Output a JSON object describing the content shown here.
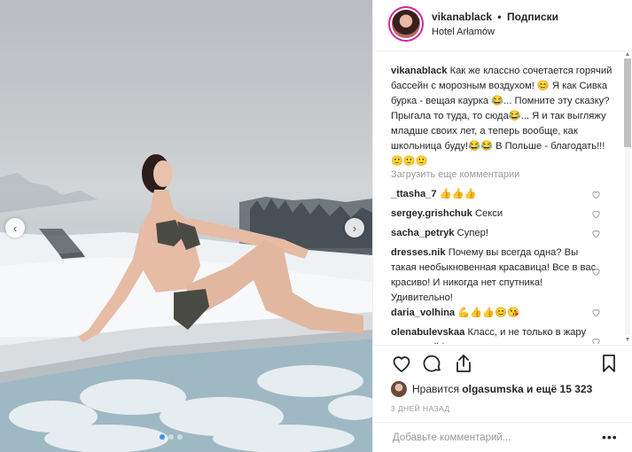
{
  "post": {
    "username": "vikanablack",
    "separator": "•",
    "follow_label": "Подписки",
    "location": "Hotel Arłamów"
  },
  "caption": {
    "username": "vikanablack",
    "text": "Как же классно сочетается горячий бассейн с морозным воздухом! 😊 Я как Сивка бурка - вещая каурка 😂... Помните эту сказку? Прыгала то туда, то сюда😂... Я и так выгляжу младше своих лет, а теперь вообще, как школьница буду!😂😂 В Польше - благодать!!!🙂🙂🙂"
  },
  "load_more": "Загрузить еще комментарии",
  "comments": [
    {
      "username": "_ttasha_7",
      "text": "👍👍👍"
    },
    {
      "username": "sergey.grishchuk",
      "text": "Секси"
    },
    {
      "username": "sacha_petryk",
      "text": "Супер!"
    },
    {
      "username": "dresses.nik",
      "text": "Почему вы всегда одна? Вы такая необыкновенная красавица! Все в вас красиво! И никогда нет спутника! Удивительно!"
    },
    {
      "username": "daria_volhina",
      "text": "💪👍👍😊😘"
    },
    {
      "username": "olenabulevskaa",
      "text": "Класс, и не только в жару можно кайф получить от"
    }
  ],
  "likes": {
    "prefix": "Нравится",
    "user": "olgasumska",
    "suffix": "и ещё 15 323"
  },
  "timestamp": "3 ДНЕЙ НАЗАД",
  "add_comment_placeholder": "Добавьте комментарий...",
  "icons": {
    "prev": "chevron-left-icon",
    "next": "chevron-right-icon",
    "like": "heart-icon",
    "comment": "comment-icon",
    "share": "share-icon",
    "save": "bookmark-icon",
    "more": "more-dots-icon"
  },
  "colors": {
    "accent_blue": "#3897f0",
    "text": "#262626",
    "muted": "#999999",
    "border": "#efefef"
  }
}
